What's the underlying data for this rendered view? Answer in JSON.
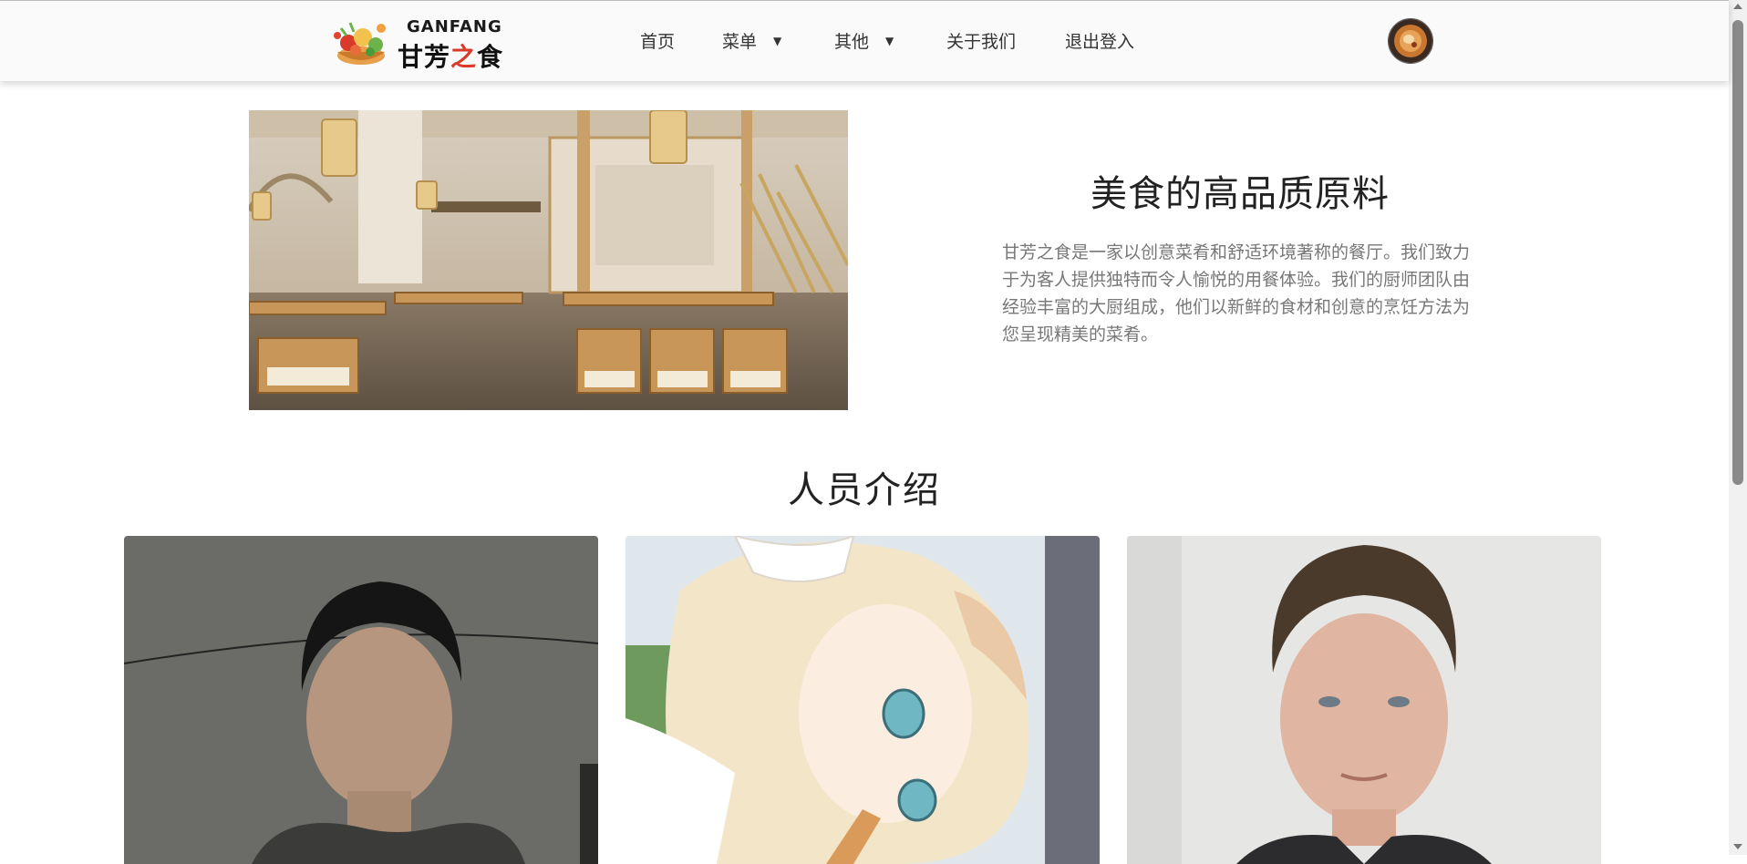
{
  "navbar": {
    "logo": {
      "en": "GANFANG",
      "cn_a": "甘芳",
      "cn_b": "之",
      "cn_c": "食"
    },
    "items": [
      {
        "label": "首页",
        "dropdown": false
      },
      {
        "label": "菜单",
        "dropdown": true,
        "caret": "▼"
      },
      {
        "label": "其他",
        "dropdown": true,
        "caret": "▼"
      },
      {
        "label": "关于我们",
        "dropdown": false
      },
      {
        "label": "退出登入",
        "dropdown": false
      }
    ]
  },
  "about": {
    "title": "美食的高品质原料",
    "description": "甘芳之食是一家以创意菜肴和舒适环境著称的餐厅。我们致力于为客人提供独特而令人愉悦的用餐体验。我们的厨师团队由经验丰富的大厨组成，他们以新鲜的食材和创意的烹饪方法为您呈现精美的菜肴。"
  },
  "team": {
    "title": "人员介绍",
    "members": [
      {
        "photo": "young-man-selfie"
      },
      {
        "photo": "anime-girl-illustration"
      },
      {
        "photo": "man-portrait"
      }
    ]
  },
  "colors": {
    "logo_accent": "#d93a2b",
    "nav_text": "#333333",
    "desc_text": "#777777"
  }
}
